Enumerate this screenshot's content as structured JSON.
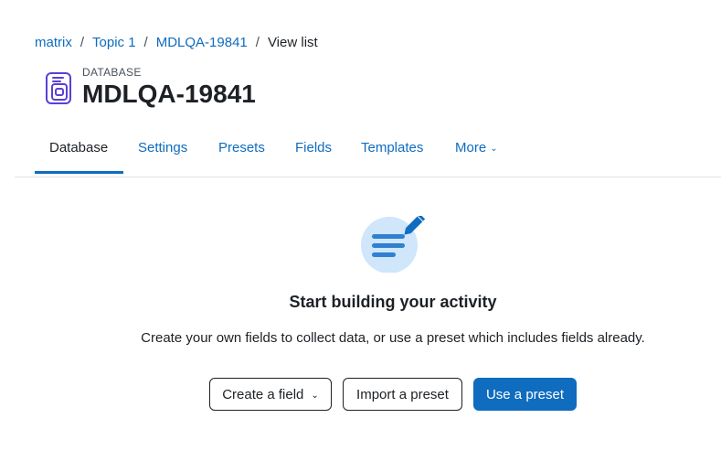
{
  "breadcrumb": {
    "items": [
      "matrix",
      "Topic 1",
      "MDLQA-19841"
    ],
    "separator": "/",
    "current": "View list"
  },
  "header": {
    "module_type": "DATABASE",
    "title": "MDLQA-19841",
    "icon": "database-icon"
  },
  "tabs": [
    {
      "label": "Database",
      "active": true
    },
    {
      "label": "Settings"
    },
    {
      "label": "Presets"
    },
    {
      "label": "Fields"
    },
    {
      "label": "Templates"
    },
    {
      "label": "More",
      "icon": "chevron-down-icon"
    }
  ],
  "empty_state": {
    "icon": "notes-pencil-icon",
    "title": "Start building your activity",
    "description": "Create your own fields to collect data, or use a preset which includes fields already."
  },
  "actions": {
    "create_field": "Create a field",
    "import_preset": "Import a preset",
    "use_preset": "Use a preset"
  },
  "colors": {
    "link": "#0f6cbf",
    "primary": "#0f6cbf",
    "text": "#1d2125",
    "icon_purple": "#5b3fd6",
    "illustration_light": "#cfe6fb"
  }
}
